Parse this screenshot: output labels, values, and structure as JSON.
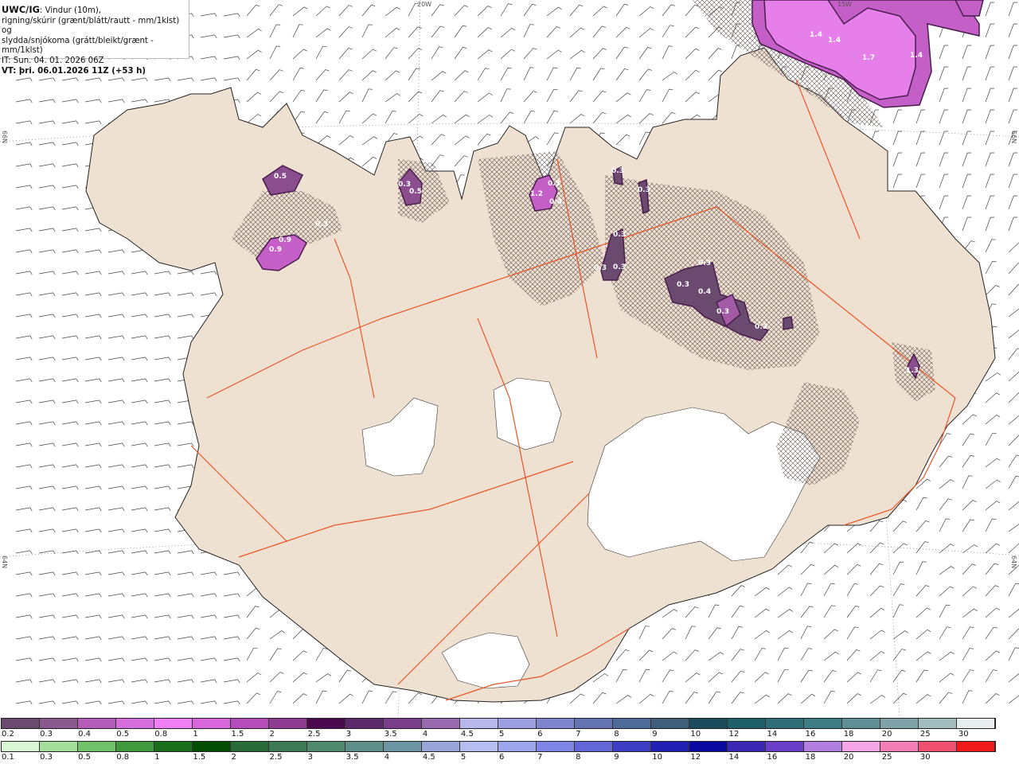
{
  "header": {
    "brand": "UWC/IG",
    "line1_rest": ": Vindur (10m),",
    "line2": "rigning/skúrir (grænt/blátt/rautt - mm/1klst) og",
    "line3": "slydda/snjókoma (grátt/bleikt/grænt - mm/1klst)",
    "it": "IT: Sun. 04. 01. 2026 06Z",
    "vt": "VT: þri. 06.01.2026 11Z (+53 h)"
  },
  "grid_labels": {
    "top_center": "20W",
    "top_right": "15W",
    "left_upper": "66N",
    "left_lower": "64N",
    "right_upper": "66N",
    "right_lower": "64N"
  },
  "colors": {
    "land": "#efe1d1",
    "sea": "#ffffff",
    "coast": "#222222",
    "roads": "#e8572a",
    "glacier": "#ffffff",
    "wind_barb": "#333333"
  },
  "snow_cells": [
    {
      "label": "0.5"
    },
    {
      "label": "0.3"
    },
    {
      "label": "0.5"
    },
    {
      "label": "0.9"
    },
    {
      "label": "0.9"
    },
    {
      "label": "0.3"
    },
    {
      "label": "1.2"
    },
    {
      "label": "0.3"
    },
    {
      "label": "0.4"
    },
    {
      "label": "0.3"
    },
    {
      "label": "0.3"
    },
    {
      "label": "0.3"
    },
    {
      "label": "0.3"
    },
    {
      "label": "0.3"
    },
    {
      "label": "0.3"
    },
    {
      "label": "0.3"
    },
    {
      "label": "0.4"
    },
    {
      "label": "0.3"
    },
    {
      "label": "0.3"
    },
    {
      "label": "1.3"
    },
    {
      "label": "1.4"
    },
    {
      "label": "1.4"
    },
    {
      "label": "1.7"
    },
    {
      "label": "1.4"
    }
  ],
  "legend_snow": {
    "colors": [
      "#6a4a6e",
      "#8a5a8e",
      "#b35cba",
      "#d76ede",
      "#ef7ff3",
      "#d767db",
      "#b64dbb",
      "#8e3d93",
      "#4a0a4d",
      "#5a2a6a",
      "#7a3f8a",
      "#9a6ab0",
      "#b7b7ec",
      "#9b9fe0",
      "#7f86cf",
      "#6474b2",
      "#4e6a98",
      "#3e5e7a",
      "#1b4b5d",
      "#1f5f6a",
      "#2f6e77",
      "#3f7d84",
      "#5f8f94",
      "#7fa3a8",
      "#a3bcbe",
      "#e8eeee"
    ],
    "labels": [
      "0.2",
      "0.3",
      "0.4",
      "0.5",
      "0.8",
      "1",
      "1.5",
      "2",
      "2.5",
      "3",
      "3.5",
      "4",
      "4.5",
      "5",
      "6",
      "7",
      "8",
      "9",
      "10",
      "12",
      "14",
      "16",
      "18",
      "20",
      "25",
      "30"
    ]
  },
  "legend_rain": {
    "colors": [
      "#d9f7d4",
      "#a4e09b",
      "#6fc26a",
      "#3f9a3e",
      "#1a6d1a",
      "#044d04",
      "#2a6b3a",
      "#3d7a56",
      "#4f8a6f",
      "#5e8f88",
      "#6e95a2",
      "#9aa6d9",
      "#b6bdf0",
      "#9ea6ee",
      "#7f86e6",
      "#6266d6",
      "#3f3fc6",
      "#2020b5",
      "#0a0aa0",
      "#3a28b4",
      "#6a3fc8",
      "#b07fe0",
      "#f4a6e6",
      "#f47fb6",
      "#f0506f",
      "#f01a1a"
    ],
    "labels": [
      "0.1",
      "0.3",
      "0.5",
      "0.8",
      "1",
      "1.5",
      "2",
      "2.5",
      "3",
      "3.5",
      "4",
      "4.5",
      "5",
      "6",
      "7",
      "8",
      "9",
      "10",
      "12",
      "14",
      "16",
      "18",
      "20",
      "25",
      "30"
    ]
  }
}
